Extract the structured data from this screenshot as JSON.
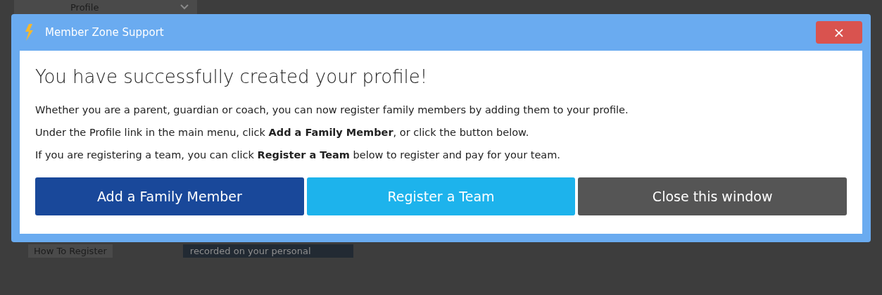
{
  "background_page": {
    "menu_item": "Profile",
    "sidebar_link": "How To Register",
    "content_text": "recorded on your personal"
  },
  "dialog": {
    "title": "Member Zone Support",
    "close_label": "×",
    "heading": "You have successfully created your profile!",
    "paragraphs": [
      "Whether you are a parent, guardian or coach, you can now register family members by adding them to your profile.",
      "Under the Profile link in the main menu, click **Add a Family Member**, or click the button below.",
      "If you are registering a team, you can click **Register a Team** below to register and pay for your team."
    ],
    "buttons": [
      {
        "label": "Add a Family Member",
        "kind": "primary"
      },
      {
        "label": "Register a Team",
        "kind": "info"
      },
      {
        "label": "Close this window",
        "kind": "dismiss"
      }
    ]
  }
}
